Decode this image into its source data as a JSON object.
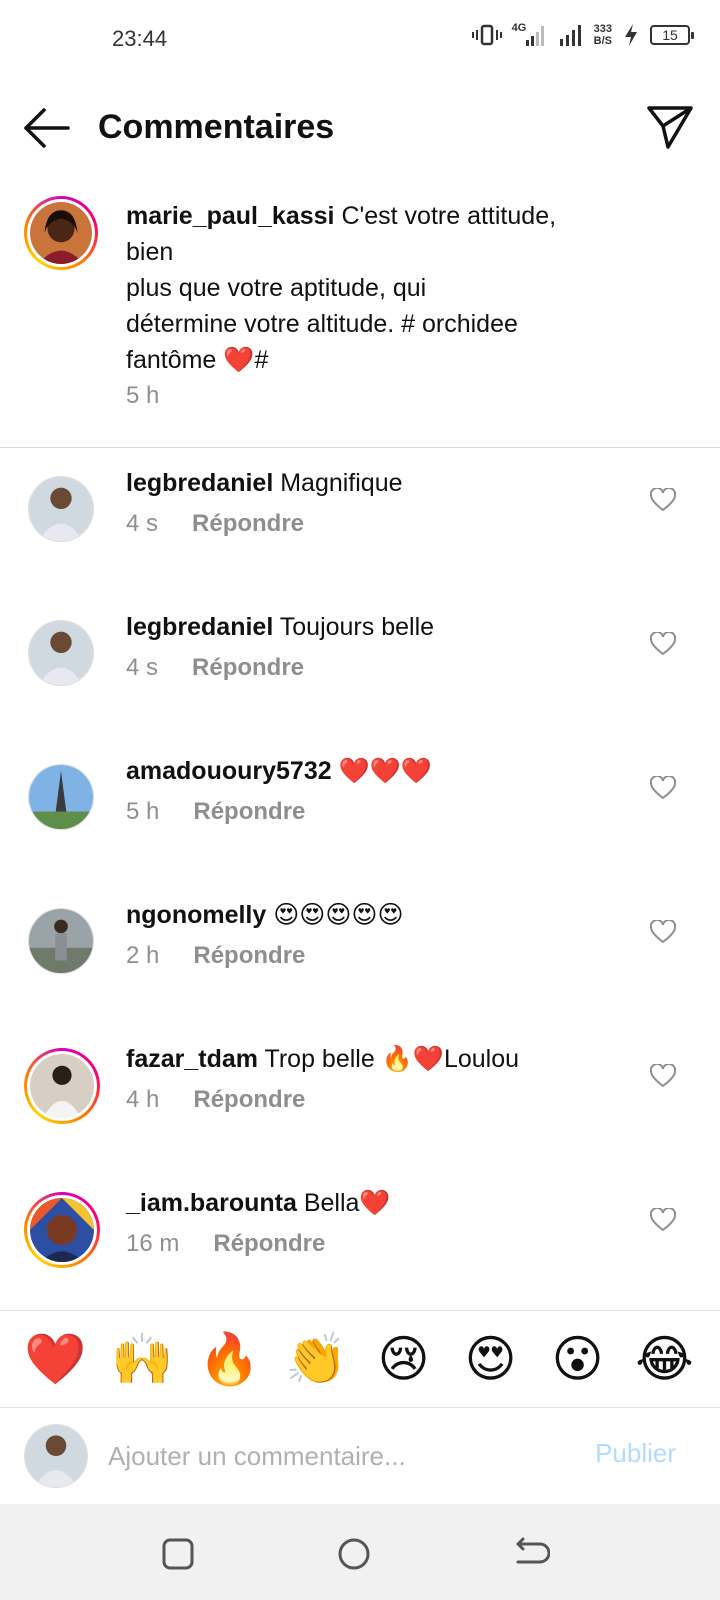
{
  "status_bar": {
    "time": "23:44",
    "network": "4G",
    "speed_value": "333",
    "speed_unit": "B/S",
    "battery": "15"
  },
  "header": {
    "title": "Commentaires",
    "back_icon": "arrow-left-icon",
    "share_icon": "send-icon"
  },
  "caption": {
    "username": "marie_paul_kassi",
    "line1": "C'est votre attitude, bien",
    "line2": "plus que votre aptitude, qui",
    "line3": "détermine votre altitude. # orchidee",
    "line4_text": "fantôme",
    "line4_emoji": "❤️",
    "line4_end": "#",
    "time": "5 h"
  },
  "comments": [
    {
      "username": "legbredaniel",
      "text": "Magnifique",
      "time": "4 s",
      "reply": "Répondre"
    },
    {
      "username": "legbredaniel",
      "text": "Toujours belle",
      "time": "4 s",
      "reply": "Répondre"
    },
    {
      "username": "amadououry5732",
      "text": "❤️❤️❤️",
      "time": "5 h",
      "reply": "Répondre"
    },
    {
      "username": "ngonomelly",
      "text": "😍😍😍😍😍",
      "time": "2 h",
      "reply": "Répondre"
    },
    {
      "username": "fazar_tdam",
      "text": "Trop belle 🔥❤️Loulou",
      "time": "4 h",
      "reply": "Répondre"
    },
    {
      "username": "_iam.barounta",
      "text": "Bella❤️",
      "time": "16 m",
      "reply": "Répondre"
    }
  ],
  "emoji_bar": [
    "❤️",
    "🙌",
    "🔥",
    "👏",
    "😢",
    "😍",
    "😮",
    "😂"
  ],
  "input": {
    "placeholder": "Ajouter un commentaire...",
    "publish_label": "Publier"
  },
  "colors": {
    "muted": "#8e8e8e",
    "publish": "#b3dbff",
    "story_ring": "#ff0069"
  }
}
